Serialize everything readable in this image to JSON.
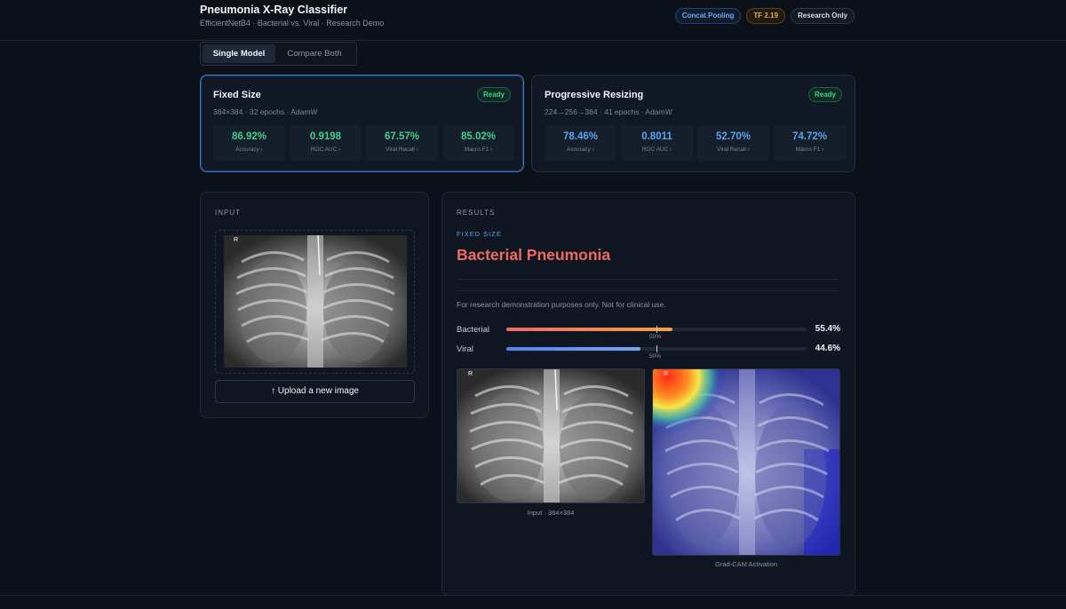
{
  "header": {
    "title": "Pneumonia X-Ray Classifier",
    "subtitle": "EfficientNetB4 · Bacterial vs. Viral · Research Demo",
    "badges": [
      "Concat Pooling",
      "TF 2.19",
      "Research Only"
    ]
  },
  "modes": {
    "single": "Single Model",
    "compare": "Compare Both",
    "active": "Single Model"
  },
  "models": [
    {
      "name": "Fixed Size",
      "meta": "384×384 · 32 epochs · AdamW",
      "status": "Ready",
      "metrics": [
        {
          "value": "86.92%",
          "label": "Accuracy ›"
        },
        {
          "value": "0.9198",
          "label": "ROC AUC ›"
        },
        {
          "value": "67.57%",
          "label": "Viral Recall ›"
        },
        {
          "value": "85.02%",
          "label": "Macro F1 ›"
        }
      ]
    },
    {
      "name": "Progressive Resizing",
      "meta": "224→256→384 · 41 epochs · AdamW",
      "status": "Ready",
      "metrics": [
        {
          "value": "78.46%",
          "label": "Accuracy ›"
        },
        {
          "value": "0.8011",
          "label": "ROC AUC ›"
        },
        {
          "value": "52.70%",
          "label": "Viral Recall ›"
        },
        {
          "value": "74.72%",
          "label": "Macro F1 ›"
        }
      ]
    }
  ],
  "input": {
    "label": "INPUT",
    "marker": "R",
    "upload_label": "↑ Upload a new image"
  },
  "results": {
    "label": "RESULTS",
    "model": "FIXED SIZE",
    "prediction": "Bacterial Pneumonia",
    "disclaimer": "For research demonstration purposes only. Not for clinical use.",
    "probabilities": [
      {
        "label": "Bacterial",
        "value": "55.4%",
        "fraction": 0.554,
        "color": "#f08a5d",
        "threshold": "50%"
      },
      {
        "label": "Viral",
        "value": "44.6%",
        "fraction": 0.446,
        "color": "#5c8ff0",
        "threshold": "50%"
      }
    ],
    "input_caption": "Input · 384×384",
    "cam_caption": "Grad-CAM Activation"
  },
  "colors": {
    "accent": "#3b78c4",
    "bacterial": "#ef6a62",
    "ready": "#3fcf8e"
  }
}
